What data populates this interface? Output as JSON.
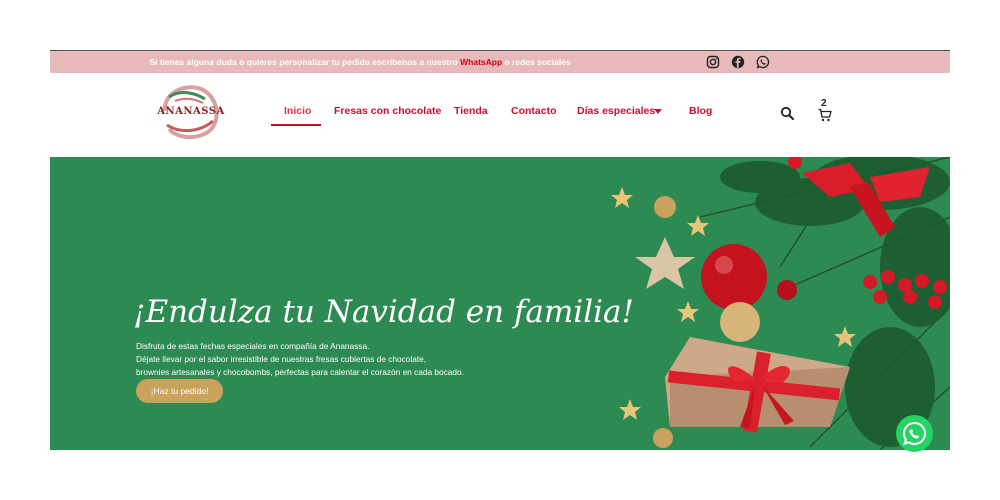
{
  "topbar": {
    "message_before": "Si tienes alguna duda o quieres personalizar tu pedido escríbenos a nuestro ",
    "message_link": "WhatsApp",
    "message_after": " o redes sociales",
    "social": [
      "instagram-icon",
      "facebook-icon",
      "whatsapp-icon"
    ]
  },
  "brand": {
    "logo_text": "ANANASSA"
  },
  "nav": {
    "items": [
      {
        "label": "Inicio"
      },
      {
        "label": "Fresas con chocolate"
      },
      {
        "label": "Tienda"
      },
      {
        "label": "Contacto"
      },
      {
        "label": "Días especiales"
      },
      {
        "label": "Blog"
      }
    ]
  },
  "header": {
    "cart_count": "2",
    "icons": [
      "search-icon",
      "cart-icon",
      "chevron-down-icon"
    ]
  },
  "hero": {
    "title": "¡Endulza tu Navidad en familia!",
    "lines": [
      "Disfruta de estas fechas especiales en compañía de Ananassa.",
      "Déjate llevar por el sabor irresistible de nuestras fresas cubiertas de chocolate,",
      "brownies artesanales y chocobombs, perfectas para calentar el corazón en cada bocado."
    ],
    "cta_label": "¡Haz tu pedido!"
  },
  "colors": {
    "topbar": "#e8b9b9",
    "nav_text": "#c8102e",
    "hero_bg": "#2d8a52",
    "cta": "#c9a35c",
    "whatsapp": "#25d366"
  }
}
